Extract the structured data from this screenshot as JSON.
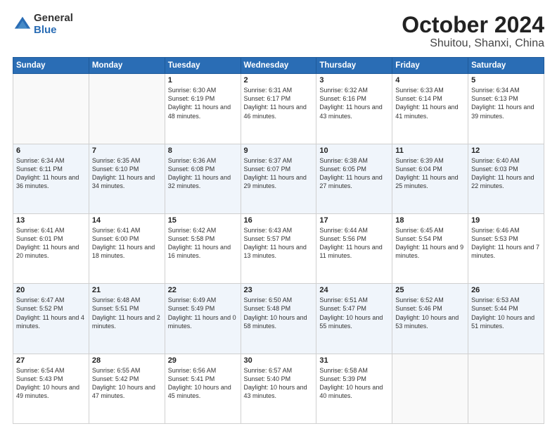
{
  "logo": {
    "general": "General",
    "blue": "Blue"
  },
  "header": {
    "title": "October 2024",
    "subtitle": "Shuitou, Shanxi, China"
  },
  "weekdays": [
    "Sunday",
    "Monday",
    "Tuesday",
    "Wednesday",
    "Thursday",
    "Friday",
    "Saturday"
  ],
  "weeks": [
    [
      {
        "day": "",
        "info": ""
      },
      {
        "day": "",
        "info": ""
      },
      {
        "day": "1",
        "info": "Sunrise: 6:30 AM\nSunset: 6:19 PM\nDaylight: 11 hours and 48 minutes."
      },
      {
        "day": "2",
        "info": "Sunrise: 6:31 AM\nSunset: 6:17 PM\nDaylight: 11 hours and 46 minutes."
      },
      {
        "day": "3",
        "info": "Sunrise: 6:32 AM\nSunset: 6:16 PM\nDaylight: 11 hours and 43 minutes."
      },
      {
        "day": "4",
        "info": "Sunrise: 6:33 AM\nSunset: 6:14 PM\nDaylight: 11 hours and 41 minutes."
      },
      {
        "day": "5",
        "info": "Sunrise: 6:34 AM\nSunset: 6:13 PM\nDaylight: 11 hours and 39 minutes."
      }
    ],
    [
      {
        "day": "6",
        "info": "Sunrise: 6:34 AM\nSunset: 6:11 PM\nDaylight: 11 hours and 36 minutes."
      },
      {
        "day": "7",
        "info": "Sunrise: 6:35 AM\nSunset: 6:10 PM\nDaylight: 11 hours and 34 minutes."
      },
      {
        "day": "8",
        "info": "Sunrise: 6:36 AM\nSunset: 6:08 PM\nDaylight: 11 hours and 32 minutes."
      },
      {
        "day": "9",
        "info": "Sunrise: 6:37 AM\nSunset: 6:07 PM\nDaylight: 11 hours and 29 minutes."
      },
      {
        "day": "10",
        "info": "Sunrise: 6:38 AM\nSunset: 6:05 PM\nDaylight: 11 hours and 27 minutes."
      },
      {
        "day": "11",
        "info": "Sunrise: 6:39 AM\nSunset: 6:04 PM\nDaylight: 11 hours and 25 minutes."
      },
      {
        "day": "12",
        "info": "Sunrise: 6:40 AM\nSunset: 6:03 PM\nDaylight: 11 hours and 22 minutes."
      }
    ],
    [
      {
        "day": "13",
        "info": "Sunrise: 6:41 AM\nSunset: 6:01 PM\nDaylight: 11 hours and 20 minutes."
      },
      {
        "day": "14",
        "info": "Sunrise: 6:41 AM\nSunset: 6:00 PM\nDaylight: 11 hours and 18 minutes."
      },
      {
        "day": "15",
        "info": "Sunrise: 6:42 AM\nSunset: 5:58 PM\nDaylight: 11 hours and 16 minutes."
      },
      {
        "day": "16",
        "info": "Sunrise: 6:43 AM\nSunset: 5:57 PM\nDaylight: 11 hours and 13 minutes."
      },
      {
        "day": "17",
        "info": "Sunrise: 6:44 AM\nSunset: 5:56 PM\nDaylight: 11 hours and 11 minutes."
      },
      {
        "day": "18",
        "info": "Sunrise: 6:45 AM\nSunset: 5:54 PM\nDaylight: 11 hours and 9 minutes."
      },
      {
        "day": "19",
        "info": "Sunrise: 6:46 AM\nSunset: 5:53 PM\nDaylight: 11 hours and 7 minutes."
      }
    ],
    [
      {
        "day": "20",
        "info": "Sunrise: 6:47 AM\nSunset: 5:52 PM\nDaylight: 11 hours and 4 minutes."
      },
      {
        "day": "21",
        "info": "Sunrise: 6:48 AM\nSunset: 5:51 PM\nDaylight: 11 hours and 2 minutes."
      },
      {
        "day": "22",
        "info": "Sunrise: 6:49 AM\nSunset: 5:49 PM\nDaylight: 11 hours and 0 minutes."
      },
      {
        "day": "23",
        "info": "Sunrise: 6:50 AM\nSunset: 5:48 PM\nDaylight: 10 hours and 58 minutes."
      },
      {
        "day": "24",
        "info": "Sunrise: 6:51 AM\nSunset: 5:47 PM\nDaylight: 10 hours and 55 minutes."
      },
      {
        "day": "25",
        "info": "Sunrise: 6:52 AM\nSunset: 5:46 PM\nDaylight: 10 hours and 53 minutes."
      },
      {
        "day": "26",
        "info": "Sunrise: 6:53 AM\nSunset: 5:44 PM\nDaylight: 10 hours and 51 minutes."
      }
    ],
    [
      {
        "day": "27",
        "info": "Sunrise: 6:54 AM\nSunset: 5:43 PM\nDaylight: 10 hours and 49 minutes."
      },
      {
        "day": "28",
        "info": "Sunrise: 6:55 AM\nSunset: 5:42 PM\nDaylight: 10 hours and 47 minutes."
      },
      {
        "day": "29",
        "info": "Sunrise: 6:56 AM\nSunset: 5:41 PM\nDaylight: 10 hours and 45 minutes."
      },
      {
        "day": "30",
        "info": "Sunrise: 6:57 AM\nSunset: 5:40 PM\nDaylight: 10 hours and 43 minutes."
      },
      {
        "day": "31",
        "info": "Sunrise: 6:58 AM\nSunset: 5:39 PM\nDaylight: 10 hours and 40 minutes."
      },
      {
        "day": "",
        "info": ""
      },
      {
        "day": "",
        "info": ""
      }
    ]
  ]
}
